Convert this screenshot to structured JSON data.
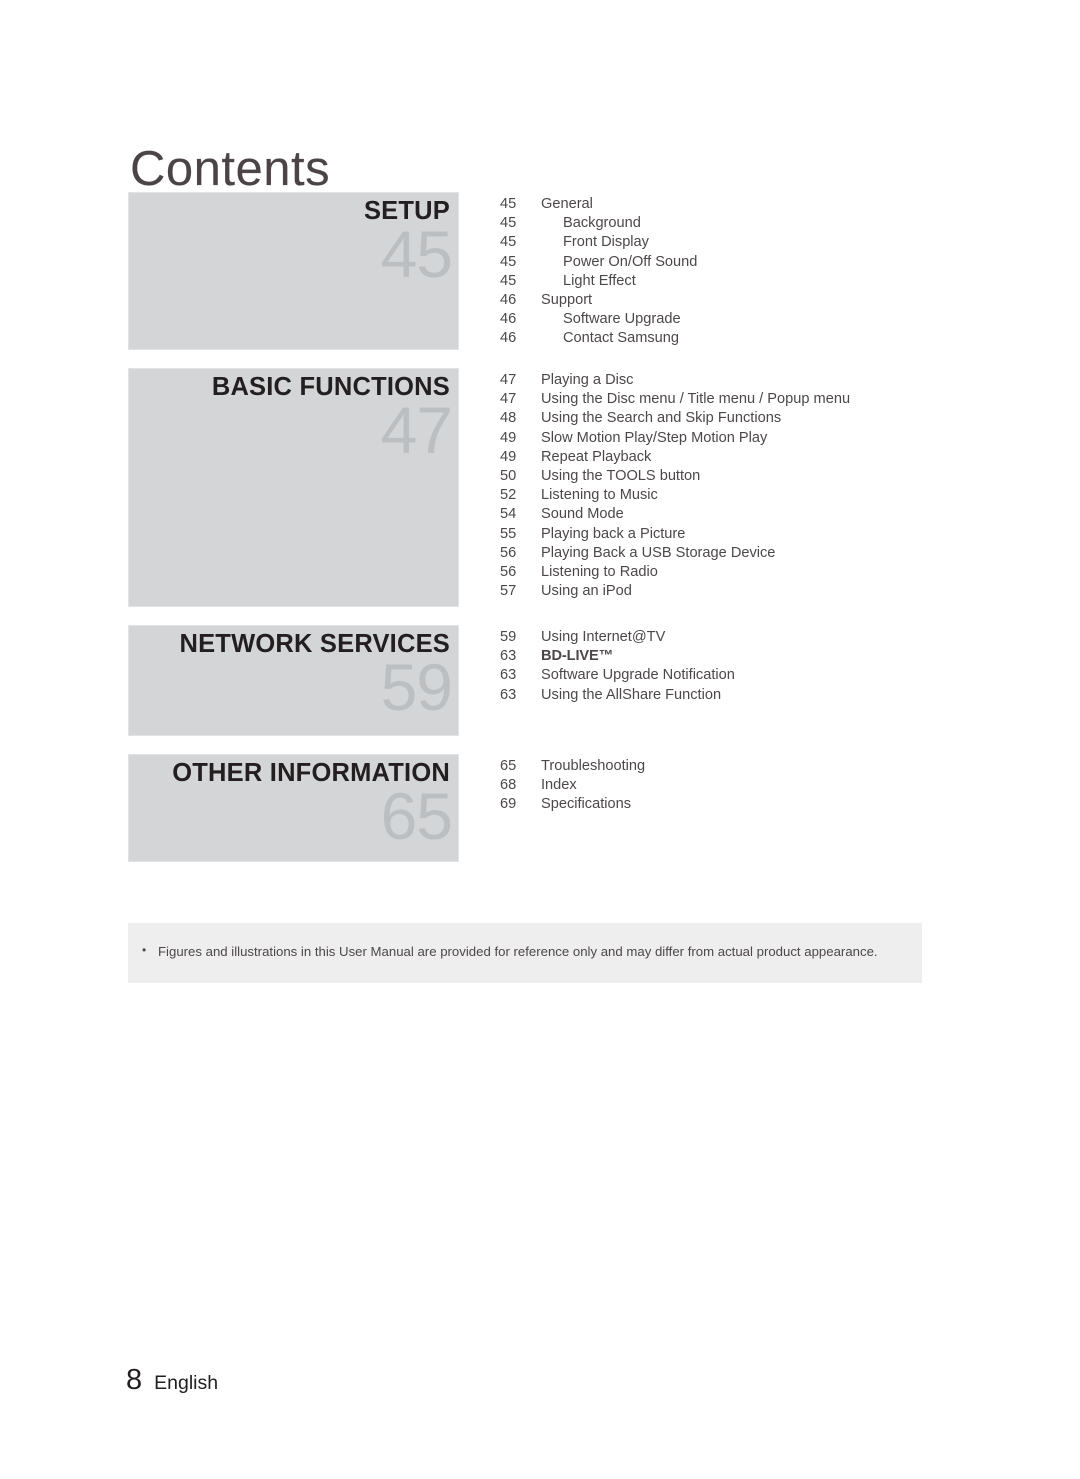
{
  "page": {
    "title": "Contents",
    "footer_number": "8",
    "footer_language": "English"
  },
  "footnote": {
    "bullet": "•",
    "text": "Figures and illustrations in this User Manual are provided for reference only and may differ from actual product appearance."
  },
  "colors": {
    "block_fill": "#d3d5d6",
    "block_border": "#e2e3e4",
    "big_number": "#bcbfc1",
    "heading_text": "#231f20",
    "body_text": "#4d4749",
    "footnote_fill": "#eeeeef"
  },
  "sections": [
    {
      "label": "SETUP",
      "number": "45",
      "block_height": 158,
      "entries": [
        {
          "page": "45",
          "title": "General",
          "level": 0,
          "bold": false
        },
        {
          "page": "45",
          "title": "Background",
          "level": 1,
          "bold": false
        },
        {
          "page": "45",
          "title": "Front Display",
          "level": 1,
          "bold": false
        },
        {
          "page": "45",
          "title": "Power On/Off Sound",
          "level": 1,
          "bold": false
        },
        {
          "page": "45",
          "title": "Light Effect",
          "level": 1,
          "bold": false
        },
        {
          "page": "46",
          "title": "Support",
          "level": 0,
          "bold": false
        },
        {
          "page": "46",
          "title": "Software Upgrade",
          "level": 1,
          "bold": false
        },
        {
          "page": "46",
          "title": "Contact Samsung",
          "level": 1,
          "bold": false
        }
      ]
    },
    {
      "label": "BASIC FUNCTIONS",
      "number": "47",
      "block_height": 239,
      "entries": [
        {
          "page": "47",
          "title": "Playing a Disc",
          "level": 0,
          "bold": false
        },
        {
          "page": "47",
          "title": "Using the Disc menu / Title menu / Popup menu",
          "level": 0,
          "bold": false
        },
        {
          "page": "48",
          "title": "Using the Search and Skip Functions",
          "level": 0,
          "bold": false
        },
        {
          "page": "49",
          "title": "Slow Motion Play/Step Motion Play",
          "level": 0,
          "bold": false
        },
        {
          "page": "49",
          "title": "Repeat Playback",
          "level": 0,
          "bold": false
        },
        {
          "page": "50",
          "title": "Using the TOOLS button",
          "level": 0,
          "bold": false
        },
        {
          "page": "52",
          "title": "Listening to Music",
          "level": 0,
          "bold": false
        },
        {
          "page": "54",
          "title": "Sound Mode",
          "level": 0,
          "bold": false
        },
        {
          "page": "55",
          "title": "Playing back a Picture",
          "level": 0,
          "bold": false
        },
        {
          "page": "56",
          "title": "Playing Back a USB Storage Device",
          "level": 0,
          "bold": false
        },
        {
          "page": "56",
          "title": "Listening to Radio",
          "level": 0,
          "bold": false
        },
        {
          "page": "57",
          "title": "Using an iPod",
          "level": 0,
          "bold": false
        }
      ]
    },
    {
      "label": "NETWORK SERVICES",
      "number": "59",
      "block_height": 111,
      "entries": [
        {
          "page": "59",
          "title": "Using Internet@TV",
          "level": 0,
          "bold": false
        },
        {
          "page": "63",
          "title": "BD-LIVE™",
          "level": 0,
          "bold": true
        },
        {
          "page": "63",
          "title": "Software Upgrade Notification",
          "level": 0,
          "bold": false
        },
        {
          "page": "63",
          "title": "Using the AllShare Function",
          "level": 0,
          "bold": false
        }
      ]
    },
    {
      "label": "OTHER INFORMATION",
      "number": "65",
      "block_height": 108,
      "entries": [
        {
          "page": "65",
          "title": "Troubleshooting",
          "level": 0,
          "bold": false
        },
        {
          "page": "68",
          "title": "Index",
          "level": 0,
          "bold": false
        },
        {
          "page": "69",
          "title": "Specifications",
          "level": 0,
          "bold": false
        }
      ]
    }
  ]
}
